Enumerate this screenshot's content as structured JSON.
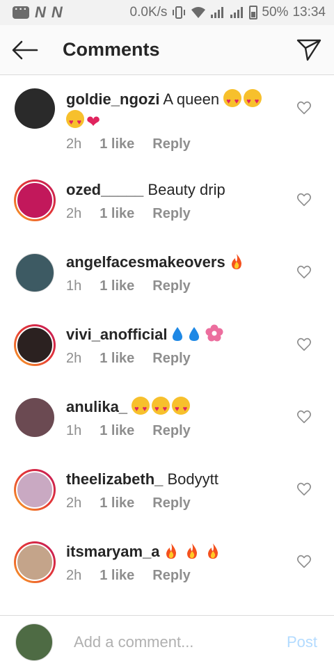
{
  "status_bar": {
    "network_speed": "0.0K/s",
    "battery_percent": "50%",
    "time": "13:34",
    "notification_icons": [
      "N",
      "N"
    ]
  },
  "header": {
    "title": "Comments"
  },
  "comments": [
    {
      "username": "goldie_ngozi",
      "text": "A queen",
      "emojis": [
        "heart-eyes",
        "heart-eyes",
        "heart-eyes",
        "pink-heart"
      ],
      "time": "2h",
      "likes": "1 like",
      "reply_label": "Reply",
      "avatar_color": "#2a2a2a",
      "story_ring": false
    },
    {
      "username": "ozed_____",
      "text": "Beauty drip",
      "emojis": [],
      "time": "2h",
      "likes": "1 like",
      "reply_label": "Reply",
      "avatar_color": "#c2185b",
      "story_ring": true
    },
    {
      "username": "angelfacesmakeovers",
      "text": "",
      "emojis": [
        "fire"
      ],
      "time": "1h",
      "likes": "1 like",
      "reply_label": "Reply",
      "avatar_color": "#3d5a63",
      "story_ring": false
    },
    {
      "username": "vivi_anofficial",
      "text": "",
      "emojis": [
        "droplet",
        "droplet",
        "flower"
      ],
      "time": "2h",
      "likes": "1 like",
      "reply_label": "Reply",
      "avatar_color": "#2b2120",
      "story_ring": true
    },
    {
      "username": "anulika_",
      "text": "",
      "emojis": [
        "heart-eyes",
        "heart-eyes",
        "heart-eyes"
      ],
      "time": "1h",
      "likes": "1 like",
      "reply_label": "Reply",
      "avatar_color": "#6b4a52",
      "story_ring": false
    },
    {
      "username": "theelizabeth_",
      "text": "Bodyytt",
      "emojis": [],
      "time": "2h",
      "likes": "1 like",
      "reply_label": "Reply",
      "avatar_color": "#c9a9c2",
      "story_ring": true
    },
    {
      "username": "itsmaryam_a",
      "text": "",
      "emojis": [
        "fire",
        "fire",
        "fire"
      ],
      "time": "2h",
      "likes": "1 like",
      "reply_label": "Reply",
      "avatar_color": "#c4a48a",
      "story_ring": true
    }
  ],
  "composer": {
    "placeholder": "Add a comment...",
    "value": "",
    "post_label": "Post"
  },
  "colors": {
    "accent_disabled": "#b3dbff",
    "muted_text": "#8e8e8e",
    "emoji_heart": "#e0245e"
  }
}
